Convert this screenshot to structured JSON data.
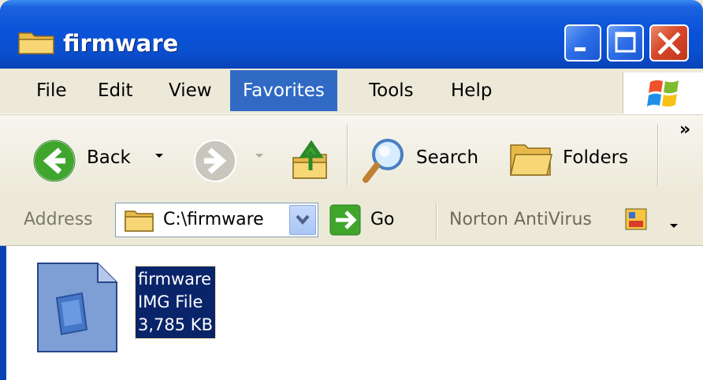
{
  "window": {
    "title": "firmware",
    "controls": [
      "minimize",
      "maximize",
      "close"
    ]
  },
  "menu": {
    "items": [
      "File",
      "Edit",
      "View",
      "Favorites",
      "Tools",
      "Help"
    ],
    "active": "Favorites"
  },
  "toolbar": {
    "back_label": "Back",
    "search_label": "Search",
    "folders_label": "Folders",
    "more_label": "»"
  },
  "address": {
    "label": "Address",
    "value": "C:\\firmware",
    "go_label": "Go",
    "norton_label": "Norton AntiVirus"
  },
  "files": [
    {
      "name": "firmware",
      "type": "IMG File",
      "size": "3,785 KB",
      "selected": true
    }
  ],
  "colors": {
    "title_blue": "#0a52d8",
    "menu_highlight": "#316ac5",
    "selection": "#0a246a",
    "close_red": "#d7482a"
  }
}
